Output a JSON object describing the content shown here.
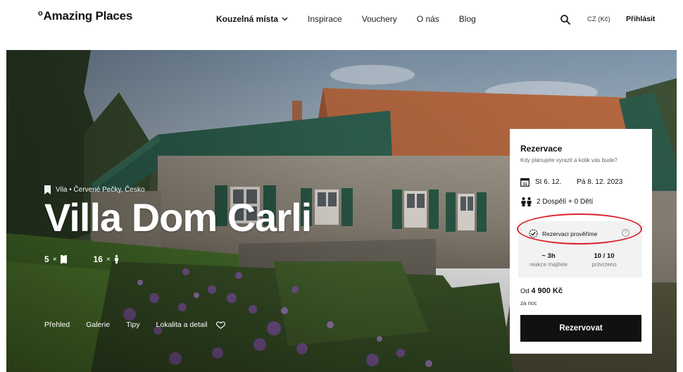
{
  "brand": {
    "logo": "Amazing Places"
  },
  "nav": {
    "items": [
      "Kouzelná místa",
      "Inspirace",
      "Vouchery",
      "O nás",
      "Blog"
    ],
    "currency": "CZ (Kč)",
    "login": "Přihlásit"
  },
  "hero": {
    "breadcrumb": "Vila • Červené Pečky, Česko",
    "title": "Villa Dom Carli",
    "rooms": "5",
    "guests": "16",
    "multiplier": "×",
    "tabs": [
      "Přehled",
      "Galerie",
      "Tipy",
      "Lokalita a detail"
    ]
  },
  "booking": {
    "title": "Rezervace",
    "subtitle": "Kdy plánujete vyrazit a kolik vás bude?",
    "calendar_day": "31",
    "date_from": "St 6. 12.",
    "date_to": "Pá 8. 12. 2023",
    "guests": "2 Dospělí + 0 Dětí",
    "verify_label": "Rezervaci prověříme",
    "verify_help": "?",
    "response_time": "~ 3h",
    "response_label": "reakce majitele",
    "confirmed": "10 / 10",
    "confirmed_label": "potvrzeno",
    "price_prefix": "Od",
    "price": "4 900 Kč",
    "price_unit": "za noc",
    "button": "Rezervovat",
    "highlight_color": "#d9232b"
  }
}
